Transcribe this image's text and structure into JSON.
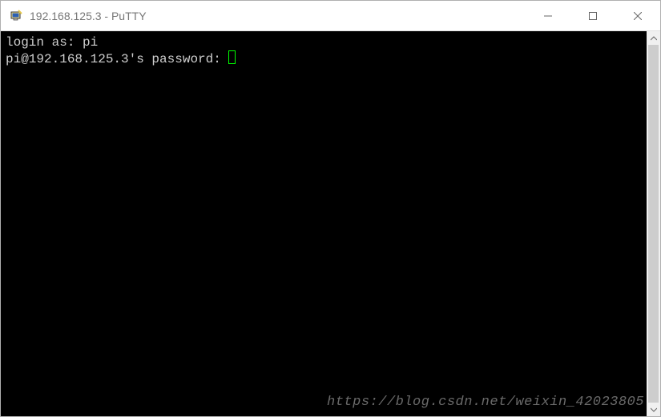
{
  "window": {
    "title": "192.168.125.3 - PuTTY"
  },
  "terminal": {
    "line1_prompt": "login as: ",
    "line1_input": "pi",
    "line2_prompt": "pi@192.168.125.3's password: "
  },
  "watermark": "https://blog.csdn.net/weixin_42023805"
}
